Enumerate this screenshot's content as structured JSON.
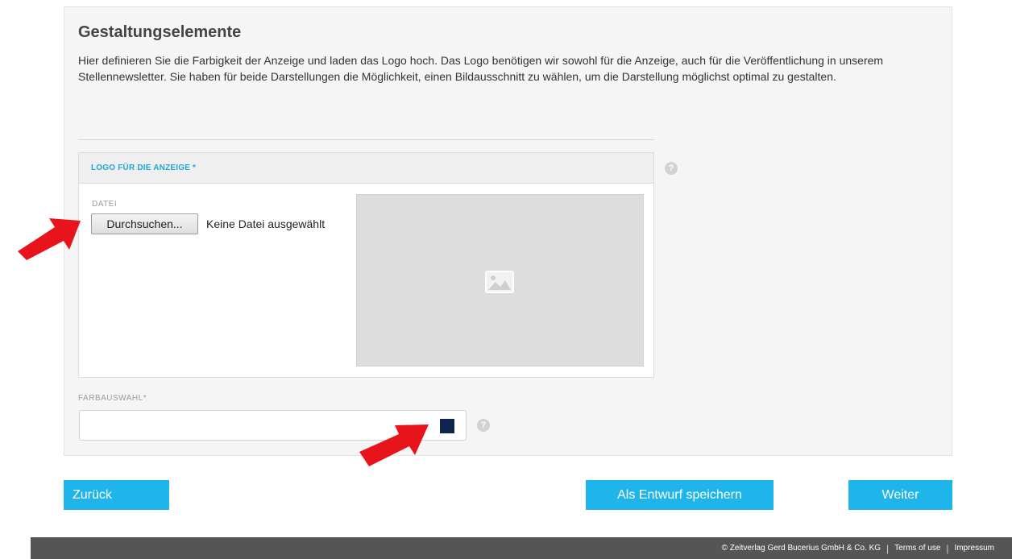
{
  "section": {
    "title": "Gestaltungselemente",
    "intro": "Hier definieren Sie die Farbigkeit der Anzeige und laden das Logo hoch. Das Logo benötigen wir sowohl für die Anzeige, auch für die Veröffentlichung in unserem Stellennewsletter. Sie haben für beide Darstellungen die Möglichkeit, einen Bildausschnitt zu wählen, um die Darstellung möglichst optimal zu gestalten."
  },
  "logo": {
    "header": "LOGO FÜR DIE ANZEIGE *",
    "file_label": "DATEI",
    "browse_button": "Durchsuchen...",
    "no_file_text": "Keine Datei ausgewählt",
    "preview_icon": "image-placeholder-icon"
  },
  "color": {
    "label": "FARBAUSWAHL*",
    "value": "",
    "swatch_color": "#0f2550"
  },
  "help_icon_glyph": "?",
  "buttons": {
    "back": "Zurück",
    "save_draft": "Als Entwurf speichern",
    "next": "Weiter"
  },
  "footer": {
    "copyright": "© Zeitverlag Gerd Bucerius GmbH & Co. KG",
    "terms": "Terms of use",
    "imprint": "Impressum",
    "separator": "|"
  },
  "colors": {
    "accent": "#1fb5ea",
    "annotation_arrow": "#e8141b",
    "footer_bg": "#555555"
  }
}
